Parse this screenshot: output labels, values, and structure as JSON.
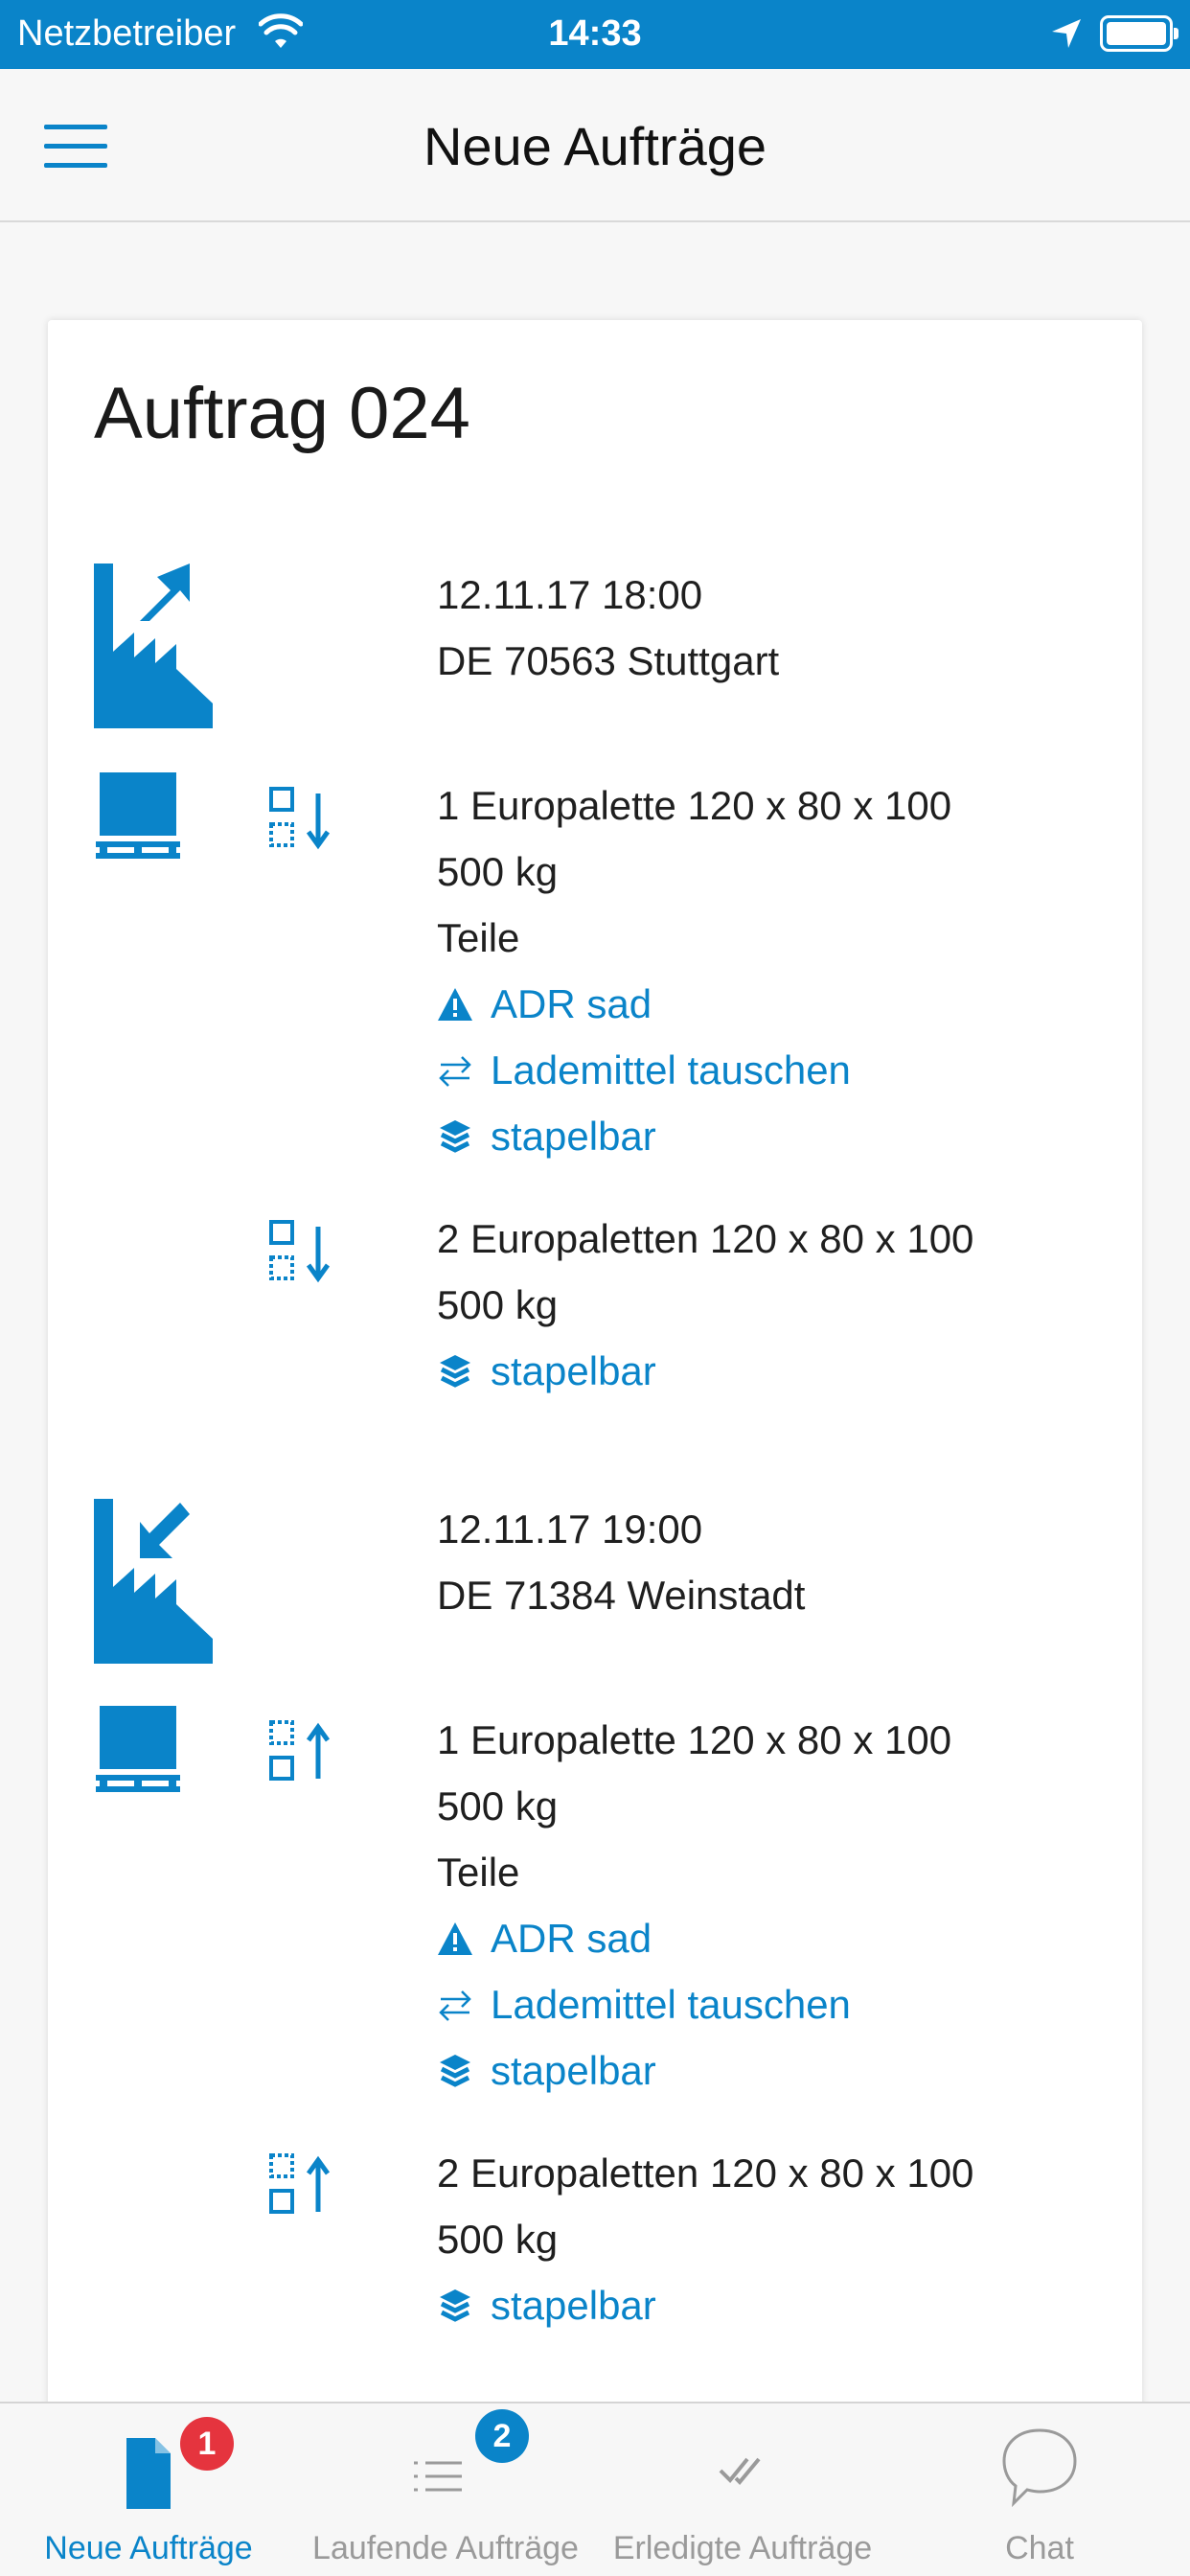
{
  "status_bar": {
    "carrier": "Netzbetreiber",
    "time": "14:33"
  },
  "nav": {
    "title": "Neue Aufträge"
  },
  "order": {
    "title": "Auftrag 024",
    "stops": [
      {
        "type": "pickup",
        "datetime": "12.11.17 18:00",
        "location": "DE 70563 Stuttgart",
        "items": [
          {
            "action": "load",
            "description": "1 Europalette 120 x 80 x 100",
            "weight": "500 kg",
            "content": "Teile",
            "tags": [
              {
                "icon": "warning-icon",
                "label": "ADR  sad"
              },
              {
                "icon": "swap-icon",
                "label": "Lademittel  tauschen"
              },
              {
                "icon": "stack-icon",
                "label": "stapelbar"
              }
            ]
          },
          {
            "action": "load",
            "description": "2 Europaletten 120 x 80 x 100",
            "weight": "500 kg",
            "tags": [
              {
                "icon": "stack-icon",
                "label": "stapelbar"
              }
            ]
          }
        ]
      },
      {
        "type": "delivery",
        "datetime": "12.11.17 19:00",
        "location": "DE 71384 Weinstadt",
        "items": [
          {
            "action": "unload",
            "description": "1 Europalette 120 x 80 x 100",
            "weight": "500 kg",
            "content": "Teile",
            "tags": [
              {
                "icon": "warning-icon",
                "label": "ADR  sad"
              },
              {
                "icon": "swap-icon",
                "label": "Lademittel  tauschen"
              },
              {
                "icon": "stack-icon",
                "label": "stapelbar"
              }
            ]
          },
          {
            "action": "unload",
            "description": "2 Europaletten 120 x 80 x 100",
            "weight": "500 kg",
            "tags": [
              {
                "icon": "stack-icon",
                "label": "stapelbar"
              }
            ]
          }
        ]
      }
    ]
  },
  "tabbar": {
    "tabs": [
      {
        "label": "Neue Aufträge",
        "badge": "1",
        "active": true,
        "icon": "document-icon"
      },
      {
        "label": "Laufende Aufträge",
        "badge": "2",
        "active": false,
        "icon": "list-icon"
      },
      {
        "label": "Erledigte Aufträge",
        "active": false,
        "icon": "double-check-icon"
      },
      {
        "label": "Chat",
        "active": false,
        "icon": "chat-bubble-icon"
      }
    ]
  },
  "colors": {
    "accent": "#0a84c9",
    "badge_red": "#e5343e",
    "inactive": "#9a9a9a"
  }
}
